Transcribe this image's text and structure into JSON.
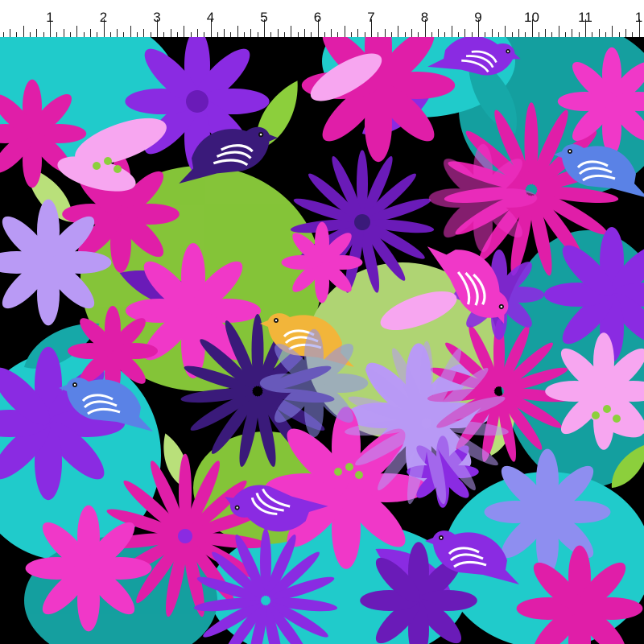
{
  "ruler": {
    "labels": [
      "1",
      "2",
      "3",
      "4",
      "5",
      "6",
      "7",
      "8",
      "9",
      "10",
      "11",
      "1"
    ],
    "unit_spacing_px": 66.5,
    "first_label_x": 62
  },
  "palette": {
    "black": "#000000",
    "turquoise": "#22d6d6",
    "teal": "#16a8a8",
    "magenta": "#e01ea8",
    "hot_pink": "#f038c8",
    "violet": "#8a2be2",
    "purple": "#6a1bb8",
    "deep_purple": "#3a1a7a",
    "lavender": "#b99af5",
    "periwinkle": "#8e8ef0",
    "pink_light": "#f7a6f0",
    "lime": "#8ccf3c",
    "lime_light": "#b9e07a",
    "yellow_bird": "#f2b53a",
    "blue_bird": "#5a82e6"
  },
  "pattern": {
    "description_hidden": true
  }
}
